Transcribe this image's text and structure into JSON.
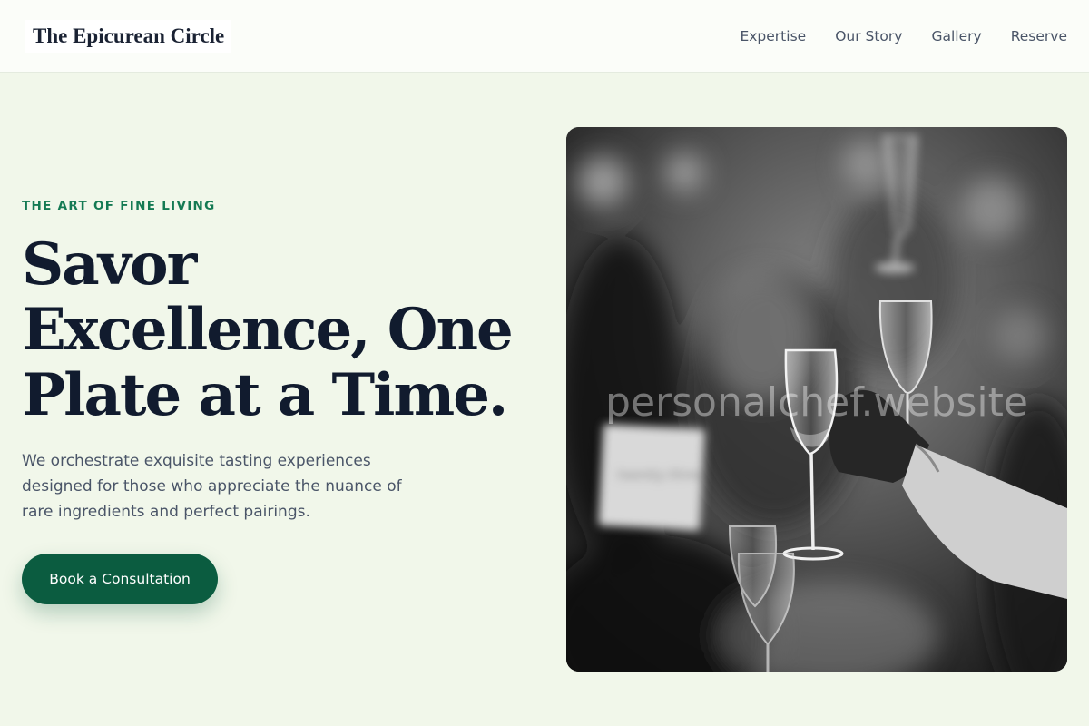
{
  "header": {
    "brand": "The Epicurean Circle",
    "nav": [
      "Expertise",
      "Our Story",
      "Gallery",
      "Reserve"
    ]
  },
  "hero": {
    "eyebrow": "THE ART OF FINE LIVING",
    "headline": "Savor Excellence, One Plate at a Time.",
    "description": "We orchestrate exquisite tasting experiences designed for those who appreciate the nuance of rare ingredients and perfect pairings.",
    "cta_label": "Book a Consultation"
  },
  "image": {
    "watermark": "personalchef.website",
    "card_text": "twenty three"
  },
  "colors": {
    "background": "#f1f7ea",
    "accent": "#0b5c40",
    "eyebrow": "#147a53",
    "heading": "#111b2e"
  }
}
